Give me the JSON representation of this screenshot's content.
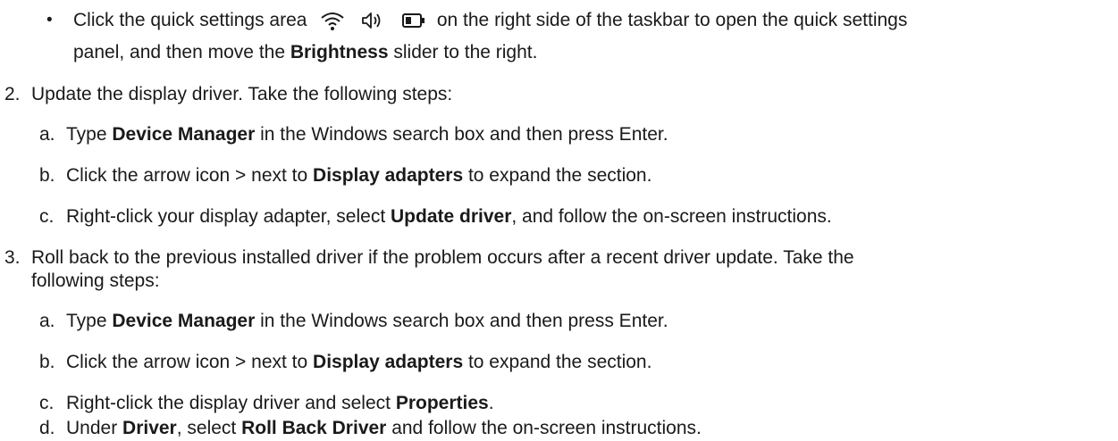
{
  "bullet_item": {
    "line1_before": "Click the quick settings area",
    "icons": [
      "wifi-icon",
      "speaker-icon",
      "battery-icon"
    ],
    "line1_after": "on the right side of the taskbar to open the quick settings",
    "line2_before": "panel, and then move the ",
    "line2_bold": "Brightness",
    "line2_after": " slider to the right."
  },
  "step2": {
    "number": "2.",
    "text": "Update the display driver. Take the following steps:",
    "substeps": [
      {
        "marker": "a.",
        "before": "Type ",
        "bold": "Device Manager",
        "after": " in the Windows search box and then press Enter."
      },
      {
        "marker": "b.",
        "before": "Click the arrow icon > next to ",
        "bold": "Display adapters",
        "after": " to expand the section."
      },
      {
        "marker": "c.",
        "before": "Right-click your display adapter, select ",
        "bold": "Update driver",
        "after": ", and follow the on-screen instructions."
      }
    ]
  },
  "step3": {
    "number": "3.",
    "line1": "Roll back to the previous installed driver if the problem occurs after a recent driver update. Take the",
    "line2": "following steps:",
    "substeps": [
      {
        "marker": "a.",
        "before": "Type ",
        "bold": "Device Manager",
        "after": " in the Windows search box and then press Enter."
      },
      {
        "marker": "b.",
        "before": "Click the arrow icon > next to ",
        "bold": "Display adapters",
        "after": " to expand the section."
      },
      {
        "marker": "c.",
        "before": "Right-click the display driver and select ",
        "bold": "Properties",
        "after": "."
      },
      {
        "marker": "d.",
        "before": "Under ",
        "bold": "Driver",
        "middle": ", select ",
        "bold2": "Roll Back Driver",
        "after": " and follow the on-screen instructions."
      }
    ]
  }
}
